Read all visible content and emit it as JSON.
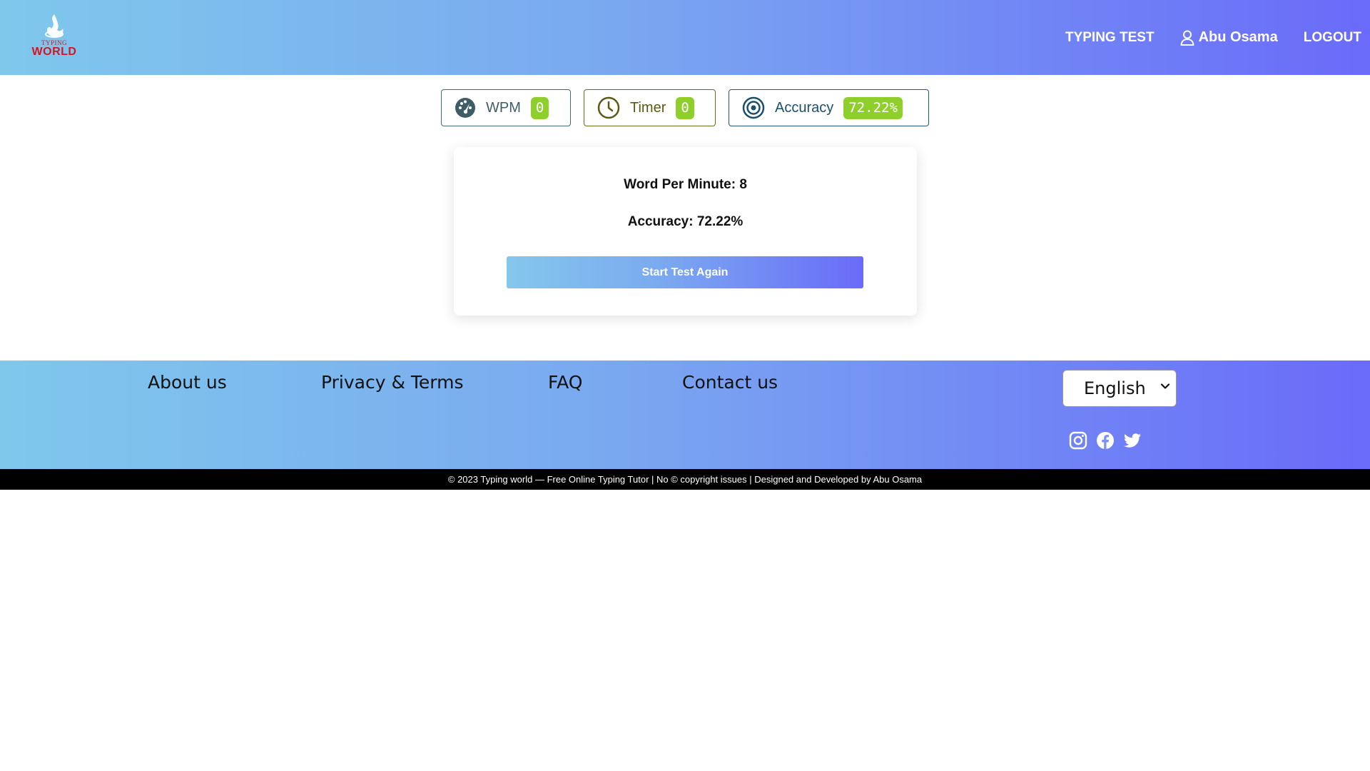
{
  "header": {
    "logo_small_text": "TYPING",
    "logo_text": "WORLD",
    "nav": {
      "typing_test": "TYPING TEST",
      "user_name": "Abu Osama",
      "logout": "LOGOUT"
    }
  },
  "stats": {
    "wpm": {
      "label": "WPM",
      "value": "0",
      "icon": "speedometer-icon"
    },
    "timer": {
      "label": "Timer",
      "value": "0",
      "icon": "clock-icon"
    },
    "accuracy": {
      "label": "Accuracy",
      "value": "72.22%",
      "icon": "target-icon"
    },
    "badge_color": "#8fcf2c"
  },
  "result": {
    "wpm_line": "Word Per Minute: 8",
    "accuracy_line": "Accuracy: 72.22%",
    "button_label": "Start Test Again"
  },
  "footer": {
    "links": {
      "about": "About us",
      "privacy": "Privacy & Terms",
      "faq": "FAQ",
      "contact": "Contact us"
    },
    "language": {
      "selected": "English"
    },
    "social": [
      "instagram-icon",
      "facebook-icon",
      "twitter-icon"
    ],
    "copyright": "© 2023 Typing world — Free Online Typing Tutor | No © copyright issues | Designed and Developed by Abu Osama"
  },
  "colors": {
    "gradient_start": "#7fc8ec",
    "gradient_end": "#6a6bf9",
    "logo_red": "#d41525"
  }
}
